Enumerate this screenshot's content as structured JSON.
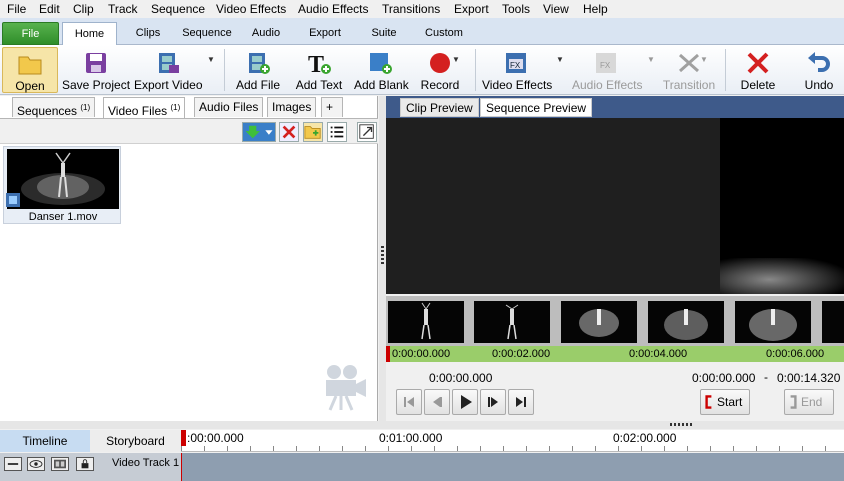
{
  "menu": [
    "File",
    "Edit",
    "Clip",
    "Track",
    "Sequence",
    "Video Effects",
    "Audio Effects",
    "Transitions",
    "Export",
    "Tools",
    "View",
    "Help"
  ],
  "ribbon_tabs": [
    "File",
    "Home",
    "Clips",
    "Sequence",
    "Audio",
    "Export",
    "Suite",
    "Custom"
  ],
  "active_ribbon_tab": "Home",
  "toolbar": {
    "open": "Open",
    "save_project": "Save Project",
    "export_video": "Export Video",
    "add_file": "Add File",
    "add_text": "Add Text",
    "add_blank": "Add Blank",
    "record": "Record",
    "video_effects": "Video Effects",
    "audio_effects": "Audio Effects",
    "transition": "Transition",
    "delete": "Delete",
    "undo": "Undo"
  },
  "bin_tabs": [
    {
      "label": "Sequences",
      "count": "(1)"
    },
    {
      "label": "Video Files",
      "count": "(1)"
    },
    {
      "label": "Audio Files",
      "count": ""
    },
    {
      "label": "Images",
      "count": ""
    },
    {
      "label": "+",
      "count": ""
    }
  ],
  "active_bin_tab": "Video Files",
  "clip": {
    "name": "Danser 1.mov"
  },
  "preview_tabs": [
    "Clip Preview",
    "Sequence Preview"
  ],
  "active_preview_tab": "Clip Preview",
  "preview_ruler": [
    "0:00:00.000",
    "0:00:02.000",
    "0:00:04.000",
    "0:00:06.000"
  ],
  "preview": {
    "current_time": "0:00:00.000",
    "range_start": "0:00:00.000",
    "range_sep": "-",
    "range_end": "0:00:14.320",
    "start_label": "Start",
    "end_label": "End"
  },
  "timeline": {
    "tabs": [
      "Timeline",
      "Storyboard"
    ],
    "active_tab": "Timeline",
    "ruler": [
      ":00:00.000",
      "0:01:00.000",
      "0:02:00.000"
    ],
    "track_name": "Video Track 1"
  },
  "colors": {
    "accent": "#3e5a8a",
    "file_tab": "#3f9e36",
    "record": "#d42020",
    "delete": "#d42020",
    "ruler_green": "#9acd6a"
  }
}
